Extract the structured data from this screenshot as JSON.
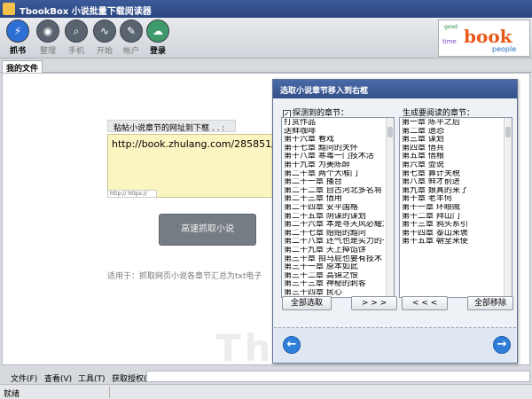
{
  "window": {
    "title": "TbookBox  小说批量下载阅读器"
  },
  "toolbar": {
    "items": [
      {
        "label": "抓书",
        "icon": "⚡"
      },
      {
        "label": "整理",
        "icon": "◉"
      },
      {
        "label": "手机",
        "icon": "⌕"
      },
      {
        "label": "开始",
        "icon": "∿"
      },
      {
        "label": "帐户",
        "icon": "✎"
      },
      {
        "label": "登录",
        "icon": "☁"
      }
    ],
    "logo_words": {
      "main": "book",
      "secondary": "people",
      "small1": "good",
      "small2": "time"
    }
  },
  "tabs": [
    {
      "label": "我的文件"
    }
  ],
  "main": {
    "url_label": "粘帖小说章节的网址到下框 . . :",
    "url_value": "http://book.zhulang.com/285851/",
    "url_hint": "http:// https://",
    "fetch_button": "高速抓取小说",
    "description": "适用于：抓取网页小说各章节汇总为txt电子",
    "watermark": "Thus Button"
  },
  "dialog": {
    "title": "选取小说章节移入到右框",
    "left_label": "探测到的章节：",
    "right_label": "生成要阅读的章节：",
    "left_items": [
      "打赏作品",
      "送鲜咖啡",
      "第十六章 看戏",
      "第十七章 黯问的关怀",
      "第十八章 寒毒一门技术活",
      "第十九章 为美陈醉",
      "第二十章 两个大喉门",
      "第二十一章 播台",
      "第二十二章 自古河北多名将",
      "第二十三章 借用",
      "第二十四章 安平国格",
      "第二十五章 阴谋的谋划",
      "第二十六章 本是寻天风必耀之",
      "第二十七章 赔赔的黯问",
      "第二十八章 还气也是实力的一部",
      "第二十九章 天上掉馅饼",
      "第三十章 拍马屁也要有技术",
      "第三十一章 原本如此",
      "第三十二章 高锦之恨",
      "第三十三章 神秘的刺客",
      "第三十四章 民心",
      "第三十五章 番耐",
      "第三十六章 水路"
    ],
    "right_items": [
      "第一章 陈平之后",
      "第二章 遗恐",
      "第三章 谋划",
      "第四章 借兵",
      "第五章 借粮",
      "第六章 壶说",
      "第七章  算计关税",
      "第八章 鲜才前进",
      "第九章   娘真的来了",
      "第十章 老羊何",
      "第十一章  环眼贼",
      "第十二章  拜山门",
      "第十三章  鸦头系引",
      "第十四章 泰山来褒",
      "第十五章 朝堂来使"
    ],
    "select_all": "全部选取",
    "move_right": "> > >",
    "move_left": "< < <",
    "remove_all": "全部移除"
  },
  "menubar": {
    "items": [
      "文件(F)",
      "查看(V)",
      "工具(T)",
      "获取授权(R)"
    ]
  },
  "status": {
    "text": "就绪"
  }
}
